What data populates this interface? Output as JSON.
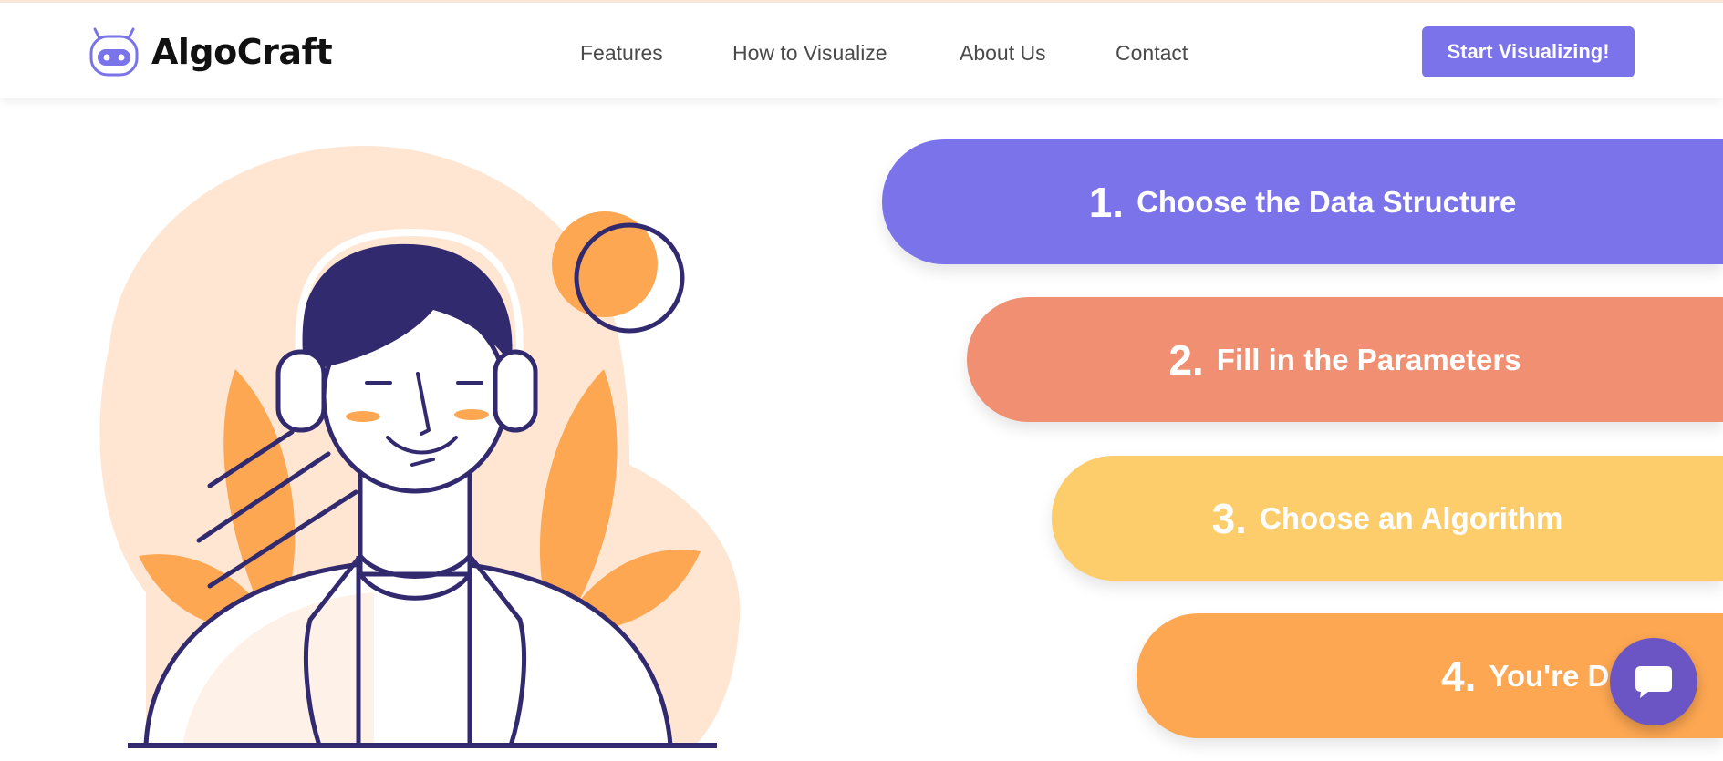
{
  "brand": {
    "name": "AlgoCraft",
    "logo_icon": "robot-logo-icon"
  },
  "nav": {
    "links": [
      "Features",
      "How to Visualize",
      "About Us",
      "Contact"
    ],
    "cta_label": "Start Visualizing!"
  },
  "steps": [
    {
      "number": "1.",
      "label": "Choose the Data Structure",
      "color": "#7b73ea"
    },
    {
      "number": "2.",
      "label": "Fill in the Parameters",
      "color": "#f08f72"
    },
    {
      "number": "3.",
      "label": "Choose an Algorithm",
      "color": "#fdcc6b"
    },
    {
      "number": "4.",
      "label": "You're Done!",
      "color": "#fda752"
    }
  ],
  "chat": {
    "icon": "chat-bubble-icon"
  },
  "colors": {
    "accent": "#7b73ea",
    "illustration_navy": "#312a6f",
    "illustration_orange": "#fda752",
    "illustration_peach": "#fee6d3"
  }
}
